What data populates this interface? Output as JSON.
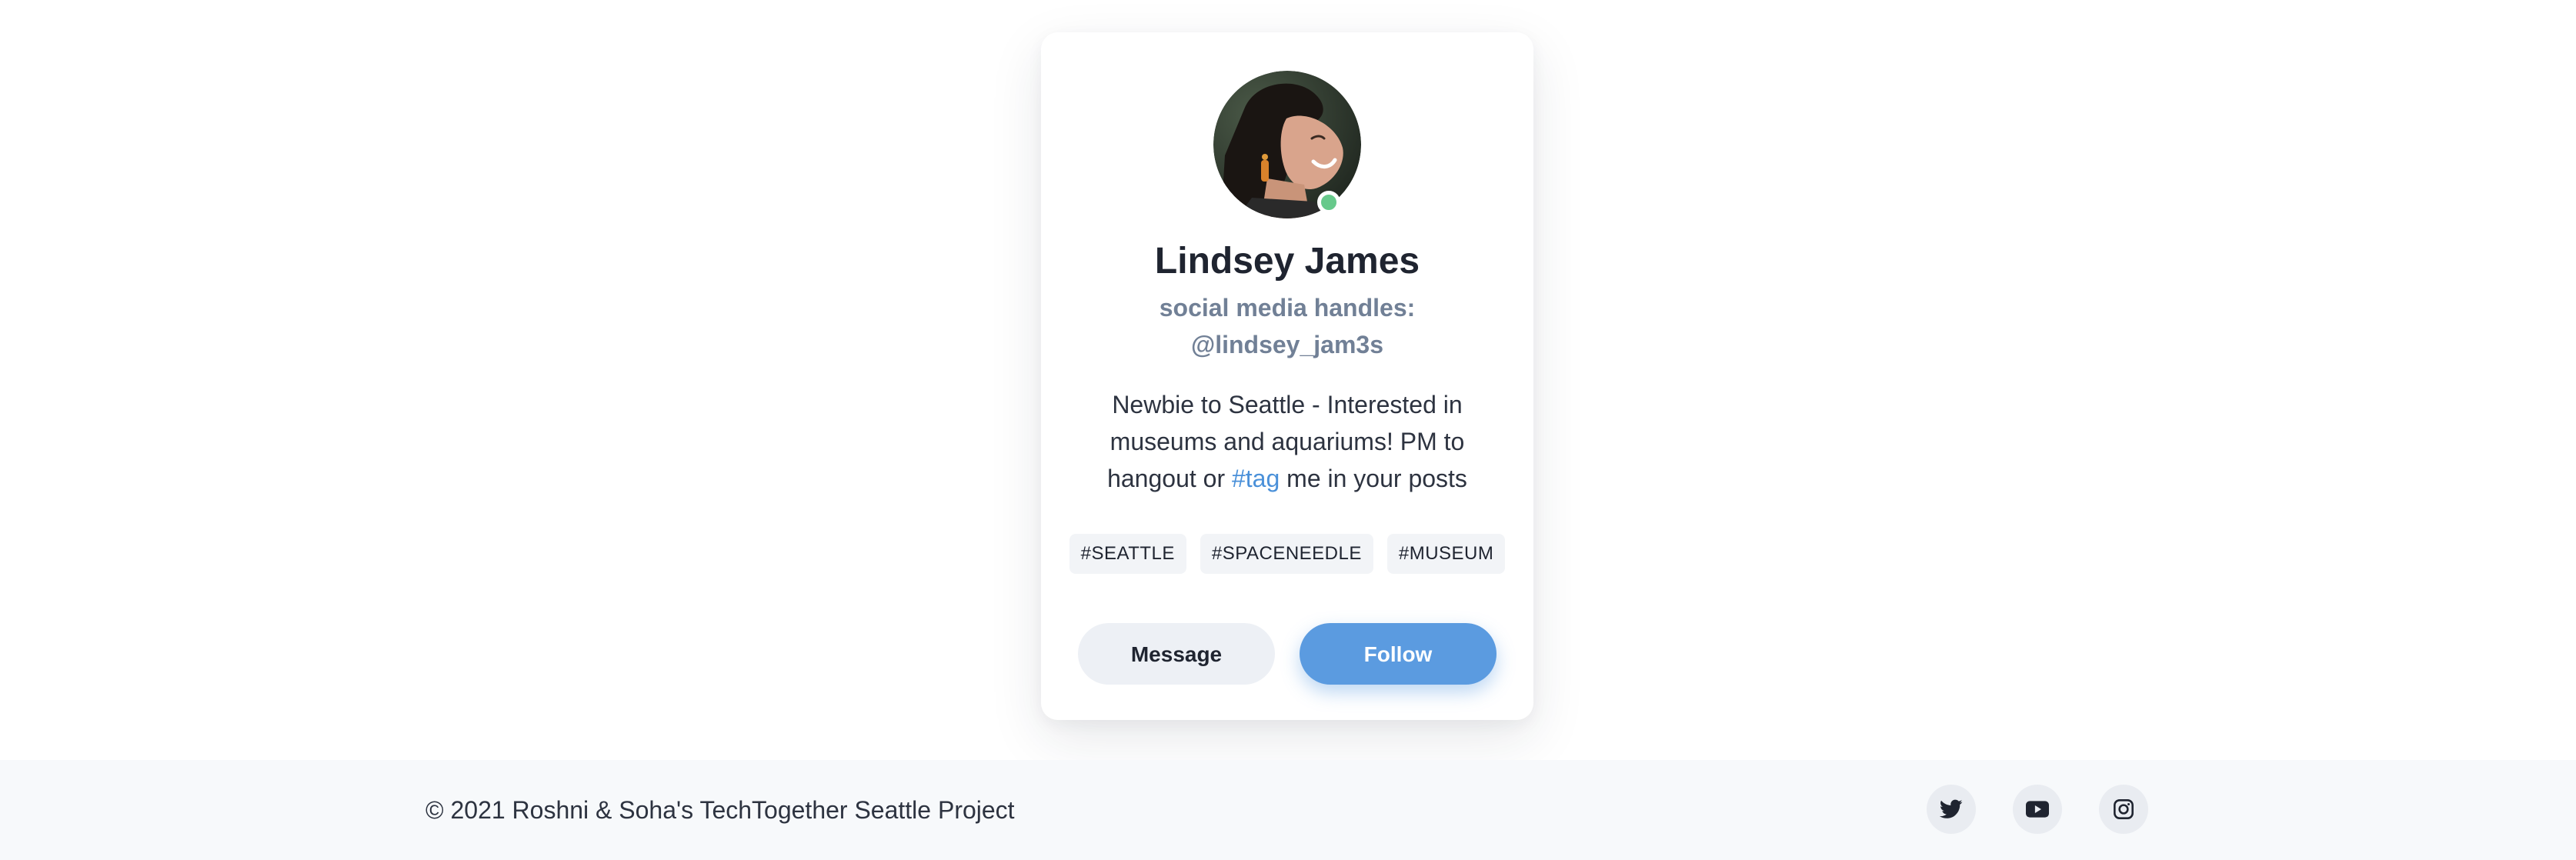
{
  "profile": {
    "name": "Lindsey James",
    "handles_label": "social media handles:",
    "handle": "@lindsey_jam3s",
    "bio_before": "Newbie to Seattle - Interested in museums and aquariums! PM to hangout or ",
    "bio_link": "#tag",
    "bio_after": " me in your posts",
    "online": true,
    "status_color": "#67c98b"
  },
  "tags": [
    "#SEATTLE",
    "#SPACENEEDLE",
    "#MUSEUM"
  ],
  "actions": {
    "message_label": "Message",
    "follow_label": "Follow"
  },
  "footer": {
    "copyright": "© 2021 Roshni & Soha's TechTogether Seattle Project",
    "social": [
      "twitter-icon",
      "youtube-icon",
      "instagram-icon"
    ]
  },
  "colors": {
    "accent": "#5b9be0",
    "link": "#4a90d9",
    "muted": "#718096"
  }
}
